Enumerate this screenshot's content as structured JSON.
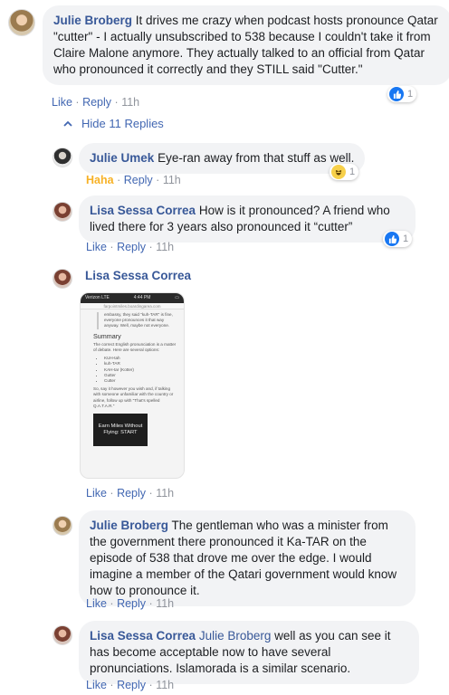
{
  "comment1": {
    "name": "Julie Broberg",
    "text": "It drives me crazy when podcast hosts pronounce Qatar \"cutter\" - I actually unsubscribed to 538 because I couldn't take it from Claire Malone anymore. They actually talked to an official from Qatar who pronounced it correctly and they STILL said \"Cutter.\"",
    "actions": {
      "like": "Like",
      "reply": "Reply",
      "time": "11h",
      "sep": "·"
    },
    "reaction": {
      "icon": "like-icon",
      "count": "1"
    }
  },
  "hide_replies": {
    "label": "Hide 11 Replies",
    "icon": "chevron-up-icon"
  },
  "reply1": {
    "name": "Julie Umek",
    "text": "Eye-ran away from that stuff as well.",
    "actions": {
      "like": "Haha",
      "reply": "Reply",
      "time": "11h",
      "sep": "·"
    },
    "reaction": {
      "icon": "haha-icon",
      "count": "1"
    }
  },
  "reply2": {
    "name": "Lisa Sessa Correa",
    "text": "How is it pronounced? A friend who lived there for 3 years also pronounced it “cutter”",
    "actions": {
      "like": "Like",
      "reply": "Reply",
      "time": "11h",
      "sep": "·"
    },
    "reaction": {
      "icon": "like-icon",
      "count": "1"
    }
  },
  "reply3": {
    "name": "Lisa Sessa Correa",
    "actions": {
      "like": "Like",
      "reply": "Reply",
      "time": "11h",
      "sep": "·"
    },
    "screenshot": {
      "status_left": "Verizon LTE",
      "status_time": "4:44 PM",
      "url": "farpointmiles.boardingarea.com",
      "quote": "embassy, they said \"kuh-TAR\" is fine, everyone pronounces it that way anyway. Well, maybe not everyone.",
      "heading": "Summary",
      "intro": "The correct English pronunciation is a matter of debate. Here are several options:",
      "options": [
        "KUH-tah",
        "kuh-TAR",
        "KAH-tar (Kotter)",
        "Gutter",
        "Cutter"
      ],
      "outro": "So, say it however you wish and, if talking with someone unfamiliar with the country or airline, follow up with \"That's spelled Q.A.T.A.R.\"",
      "ad": "Earn Miles Without Flying: START"
    }
  },
  "reply4": {
    "name": "Julie Broberg",
    "text": "The gentleman who was a minister from the government there pronounced it Ka-TAR on the episode of 538 that drove me over the edge. I would imagine a member of the Qatari government would know how to pronounce it.",
    "actions": {
      "like": "Like",
      "reply": "Reply",
      "time": "11h",
      "sep": "·"
    }
  },
  "reply5": {
    "name": "Lisa Sessa Correa",
    "mention": "Julie Broberg",
    "text": "well as you can see it has become acceptable now to have several pronunciations. Islamorada is a similar scenario.",
    "actions": {
      "like": "Like",
      "reply": "Reply",
      "time": "11h",
      "sep": "·"
    }
  },
  "colors": {
    "link": "#4267b2",
    "name": "#385898",
    "bubble": "#f2f3f5",
    "muted": "#90949c",
    "like_blue": "#1877f2",
    "haha_yellow": "#f7b125"
  }
}
